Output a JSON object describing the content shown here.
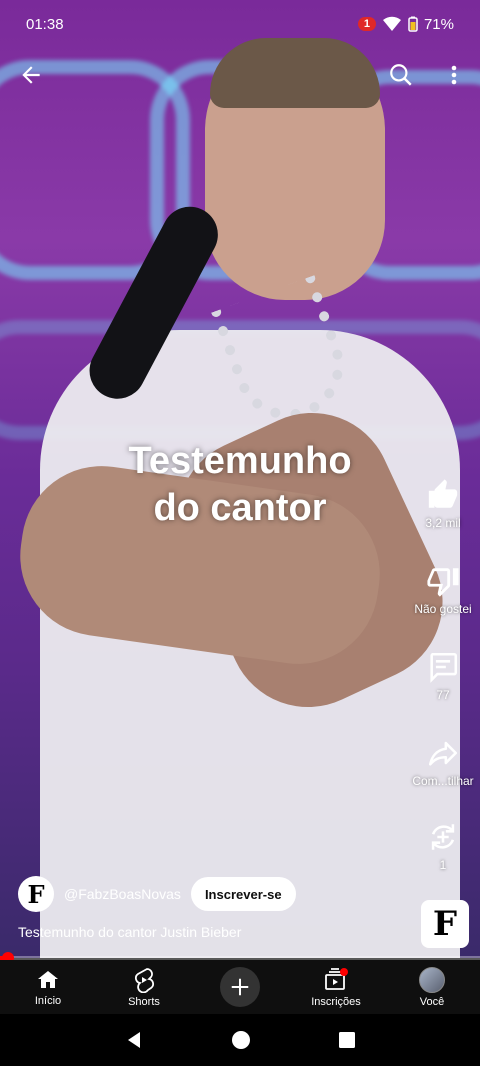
{
  "status_bar": {
    "time": "01:38",
    "notification_count": "1",
    "battery": "71%"
  },
  "video": {
    "overlay_text_line1": "Testemunho",
    "overlay_text_line2": "do cantor"
  },
  "actions": {
    "like_count": "3,2 mil",
    "dislike_label": "Não gostei",
    "comments_count": "77",
    "share_label": "Com...tilhar",
    "remix_count": "1"
  },
  "channel": {
    "avatar_letter": "F",
    "handle": "@FabzBoasNovas",
    "subscribe_label": "Inscrever-se"
  },
  "description": "Testemunho do cantor Justin Bieber",
  "sound_thumb_letter": "F",
  "progress": 0.02,
  "bottom_nav": {
    "home": "Início",
    "shorts": "Shorts",
    "subscriptions": "Inscrições",
    "you": "Você"
  },
  "colors": {
    "accent_red": "#ff0000",
    "nav_bg": "#0f0f0f"
  }
}
